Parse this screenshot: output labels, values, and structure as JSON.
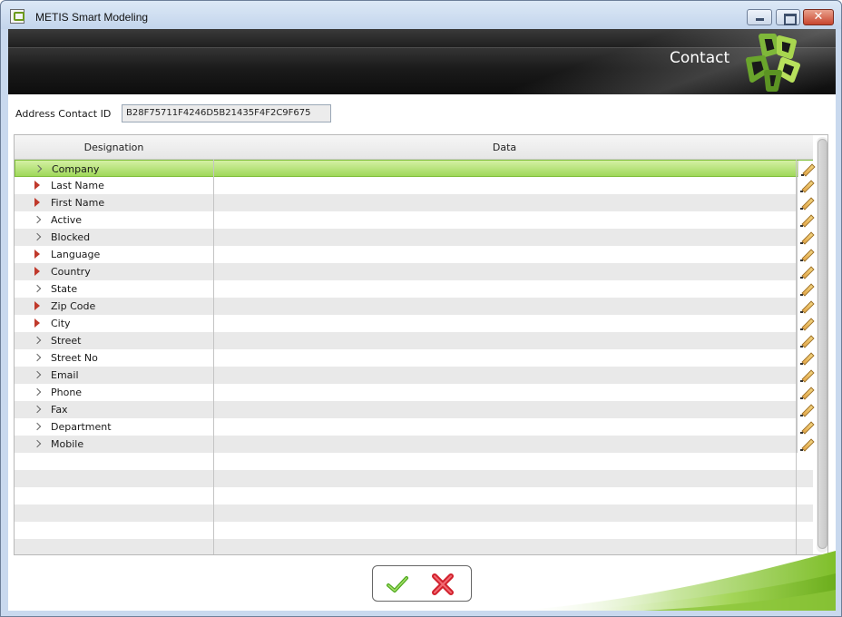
{
  "window": {
    "title": "METIS Smart Modeling",
    "close_label": "✕"
  },
  "banner": {
    "title": "Contact"
  },
  "id_row": {
    "label": "Address Contact ID",
    "value": "B28F75711F4246D5B21435F4F2C9F675"
  },
  "grid": {
    "columns": [
      "Designation",
      "Data"
    ],
    "rows": [
      {
        "name": "Company",
        "arrow": "gray",
        "selected": true
      },
      {
        "name": "Last Name",
        "arrow": "red"
      },
      {
        "name": "First Name",
        "arrow": "red"
      },
      {
        "name": "Active",
        "arrow": "gray"
      },
      {
        "name": "Blocked",
        "arrow": "gray"
      },
      {
        "name": "Language",
        "arrow": "red"
      },
      {
        "name": "Country",
        "arrow": "red"
      },
      {
        "name": "State",
        "arrow": "gray"
      },
      {
        "name": "Zip Code",
        "arrow": "red"
      },
      {
        "name": "City",
        "arrow": "red"
      },
      {
        "name": "Street",
        "arrow": "gray"
      },
      {
        "name": "Street No",
        "arrow": "gray"
      },
      {
        "name": "Email",
        "arrow": "gray"
      },
      {
        "name": "Phone",
        "arrow": "gray"
      },
      {
        "name": "Fax",
        "arrow": "gray"
      },
      {
        "name": "Department",
        "arrow": "gray"
      },
      {
        "name": "Mobile",
        "arrow": "gray"
      }
    ],
    "empty_rows": 6
  },
  "colors": {
    "accent_green": "#8dc63f",
    "selection_green": "#b4e37a",
    "required_red": "#c0392b",
    "cancel_red": "#e0303a"
  }
}
